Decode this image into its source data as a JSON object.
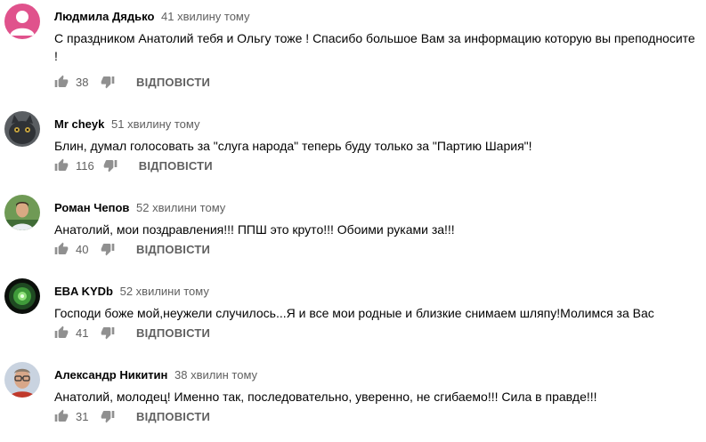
{
  "comments": [
    {
      "author": "Людмила Дядько",
      "time": "41 хвилину тому",
      "text": "С праздником Анатолий тебя и Ольгу тоже ! Спасибо большое  Вам за информацию которую вы преподносите !",
      "likes": "38",
      "reply_label": "ВІДПОВІСТИ",
      "avatar": "pink-default-avatar"
    },
    {
      "author": "Mr cheyk",
      "time": "51 хвилину тому",
      "text": "Блин, думал голосовать за \"слуга народа\" теперь буду только за \"Партию Шария\"!",
      "likes": "116",
      "reply_label": "ВІДПОВІСТИ",
      "avatar": "cat-photo-avatar"
    },
    {
      "author": "Роман Чепов",
      "time": "52 хвилини тому",
      "text": "Анатолий, мои поздравления!!! ППШ это круто!!! Обоими руками за!!!",
      "likes": "40",
      "reply_label": "ВІДПОВІСТИ",
      "avatar": "man-outdoor-photo-avatar"
    },
    {
      "author": "EBA KYDb",
      "time": "52 хвилини тому",
      "text": "Господи боже мой,неужели случилось...Я и все мои родные и близкие снимаем шляпу!Молимся за Вас",
      "likes": "41",
      "reply_label": "ВІДПОВІСТИ",
      "avatar": "green-planet-avatar"
    },
    {
      "author": "Александр Никитин",
      "time": "38 хвилин тому",
      "text": "Анатолий, молодец! Именно так, последовательно, уверенно, не сгибаемо!!! Сила в правде!!!",
      "likes": "31",
      "reply_label": "ВІДПОВІСТИ",
      "avatar": "man-glasses-photo-avatar"
    }
  ],
  "colors": {
    "text": "#030303",
    "secondary": "#606060",
    "pink_avatar": "#e0528c"
  }
}
